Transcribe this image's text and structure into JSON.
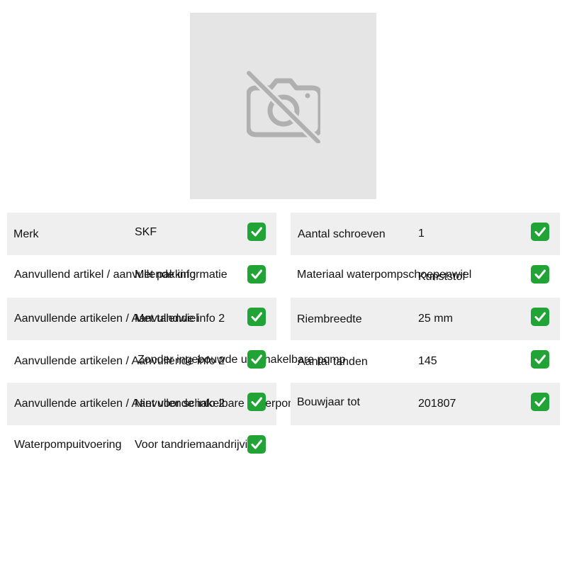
{
  "image": {
    "icon": "camera-off-icon"
  },
  "specs_left": [
    {
      "label": "Merk",
      "value": "SKF",
      "icon": "check-icon"
    },
    {
      "label": "Aanvullend artikel / aanvullende informatie",
      "value": "Met pakking",
      "icon": "check-icon"
    },
    {
      "label": "Aanvullende artikelen / Aanvullende info 2",
      "value": "Met tandwiel",
      "icon": "check-icon"
    },
    {
      "label": "Aanvullende artikelen / Aanvullende info 2",
      "value": "Zonder ingebouwde uitschakelbare pomp",
      "icon": "check-icon"
    },
    {
      "label": "Aanvullende artikelen / Aanvullende info 2",
      "value": "Niet voor schakelbare waterpomp",
      "icon": "check-icon"
    },
    {
      "label": "Waterpompuitvoering",
      "value": "Voor tandriemaandrijving",
      "icon": "check-icon"
    }
  ],
  "specs_right": [
    {
      "label": "Aantal schroeven",
      "value": "1",
      "icon": "check-icon"
    },
    {
      "label": "Materiaal waterpompschoepenwiel",
      "value": "Kunststof",
      "icon": "check-icon"
    },
    {
      "label": "Riembreedte",
      "value": "25 mm",
      "icon": "check-icon"
    },
    {
      "label": "Aantal tanden",
      "value": "145",
      "icon": "check-icon"
    },
    {
      "label": "Bouwjaar tot",
      "value": "201807",
      "icon": "check-icon"
    }
  ],
  "colors": {
    "check_bg": "#21a336",
    "row_shade": "#efefef",
    "image_bg": "#e5e5e5",
    "icon_gray": "#b0b0b0"
  }
}
